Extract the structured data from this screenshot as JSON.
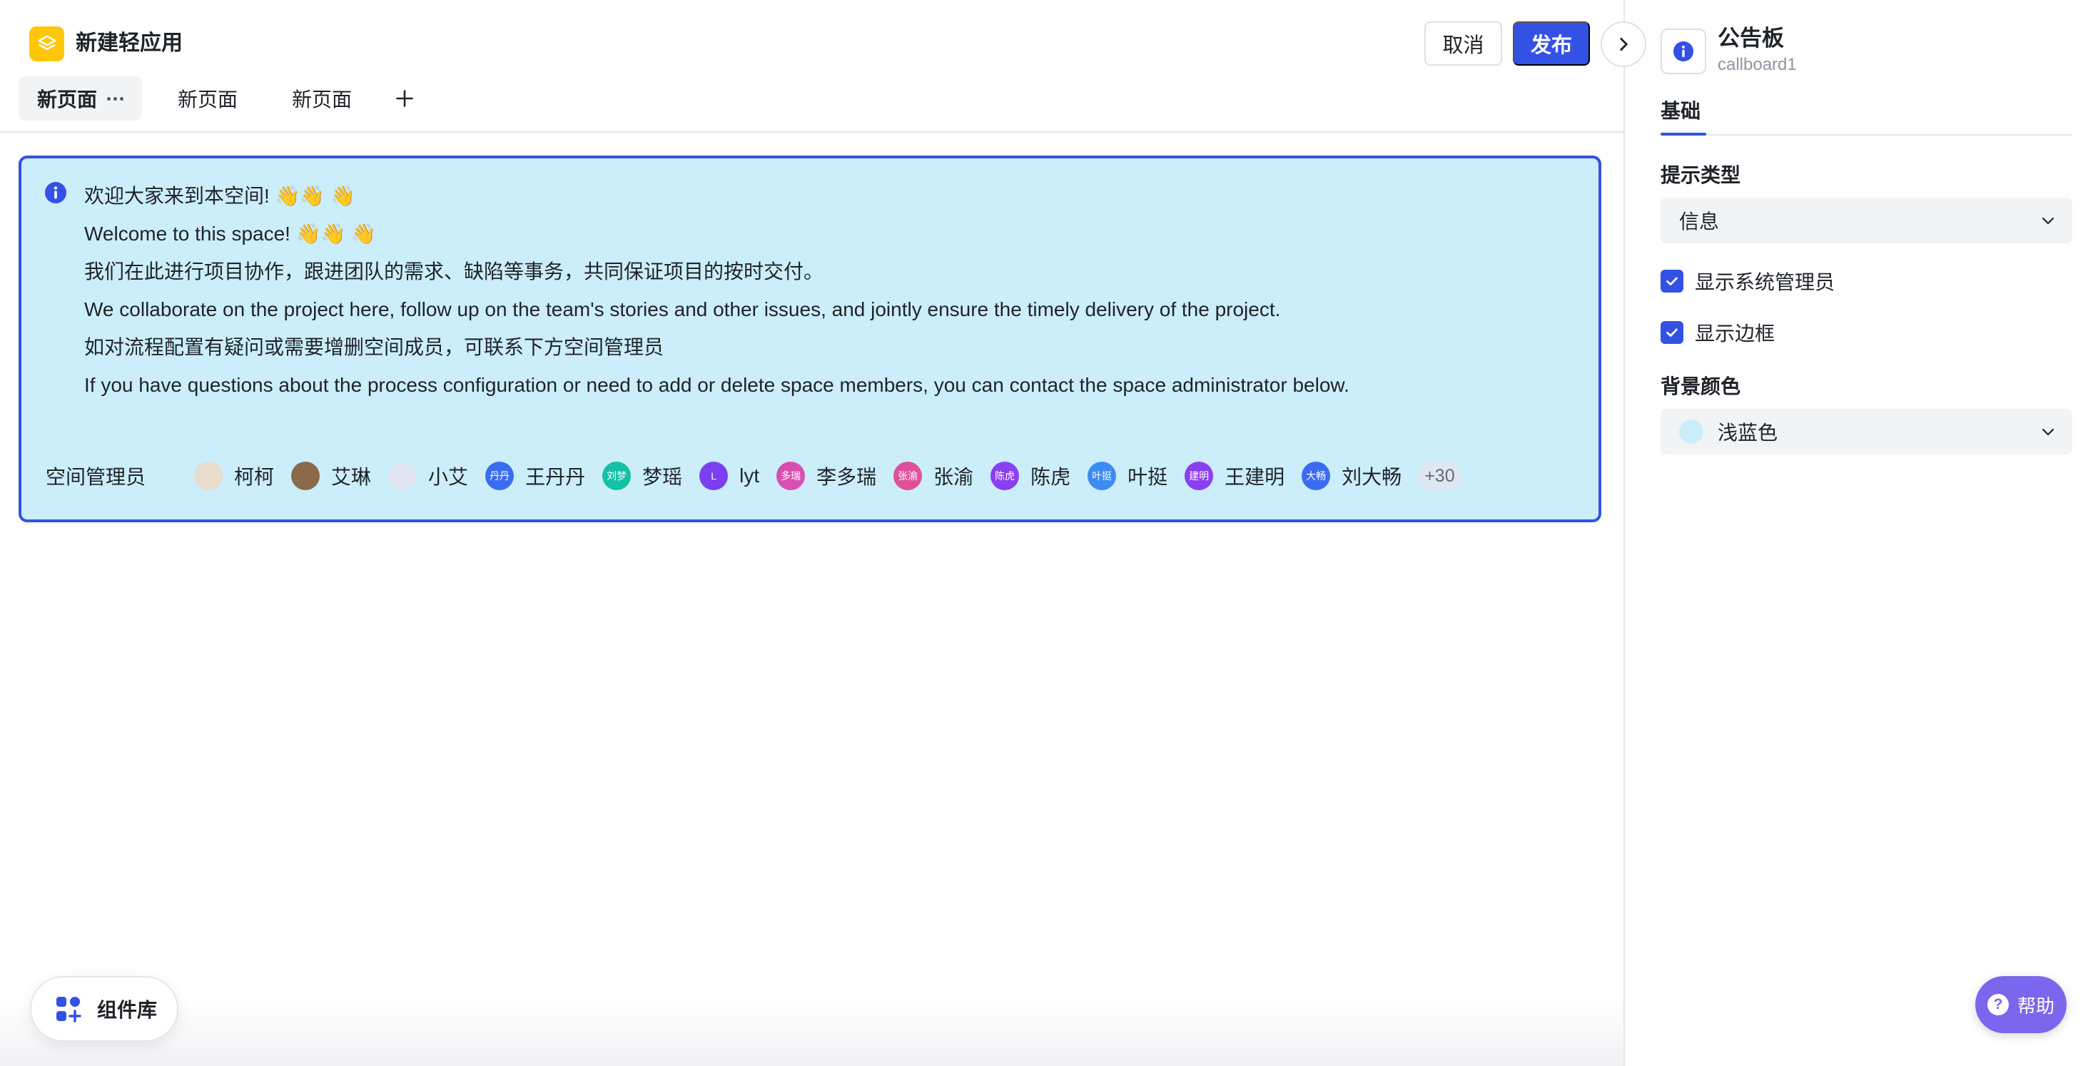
{
  "app": {
    "title": "新建轻应用",
    "logo_icon": "layers-icon",
    "logo_color": "#ffc60a"
  },
  "tabs": [
    {
      "label": "新页面",
      "active": true,
      "has_more": true
    },
    {
      "label": "新页面",
      "active": false
    },
    {
      "label": "新页面",
      "active": false
    }
  ],
  "actions": {
    "cancel_label": "取消",
    "publish_label": "发布",
    "accent": "#3451e6"
  },
  "callboard": {
    "background": "#cbeefa",
    "border_color": "#3451e6",
    "lines": [
      "欢迎大家来到本空间! 👋👋 👋",
      "Welcome to this space! 👋👋 👋",
      "我们在此进行项目协作，跟进团队的需求、缺陷等事务，共同保证项目的按时交付。",
      "We collaborate on the project here, follow up on the team's stories and other issues, and jointly ensure the timely delivery of the project.",
      "如对流程配置有疑问或需要增删空间成员，可联系下方空间管理员",
      "If you have questions about the process configuration or need to add or delete space members, you can contact the space administrator below."
    ],
    "admins_label": "空间管理员",
    "admins": [
      {
        "name": "柯柯",
        "avatar_text": "",
        "color": "#e8dccb"
      },
      {
        "name": "艾琳",
        "avatar_text": "",
        "color": "#8a6a4a"
      },
      {
        "name": "小艾",
        "avatar_text": "",
        "color": "#dfe6f2"
      },
      {
        "name": "王丹丹",
        "avatar_text": "丹丹",
        "color": "#3b6cf0"
      },
      {
        "name": "梦瑶",
        "avatar_text": "刘梦",
        "color": "#14c0a6"
      },
      {
        "name": "lyt",
        "avatar_text": "L",
        "color": "#7b3ff0"
      },
      {
        "name": "李多瑞",
        "avatar_text": "多瑞",
        "color": "#d94fb0"
      },
      {
        "name": "张渝",
        "avatar_text": "张渝",
        "color": "#e0509a"
      },
      {
        "name": "陈虎",
        "avatar_text": "陈虎",
        "color": "#8a3ff0"
      },
      {
        "name": "叶挺",
        "avatar_text": "叶挺",
        "color": "#3b8cf0"
      },
      {
        "name": "王建明",
        "avatar_text": "建明",
        "color": "#8a3ff0"
      },
      {
        "name": "刘大畅",
        "avatar_text": "大畅",
        "color": "#3b6cf0"
      }
    ],
    "more_count": "+30"
  },
  "panel": {
    "component_title": "公告板",
    "component_id": "callboard1",
    "tab_label": "基础",
    "hint_type_label": "提示类型",
    "hint_type_value": "信息",
    "show_admin_label": "显示系统管理员",
    "show_admin_checked": true,
    "show_border_label": "显示边框",
    "show_border_checked": true,
    "bg_color_label": "背景颜色",
    "bg_color_value": "浅蓝色",
    "bg_color_swatch": "#cbeefa"
  },
  "help_label": "帮助",
  "component_library_label": "组件库"
}
